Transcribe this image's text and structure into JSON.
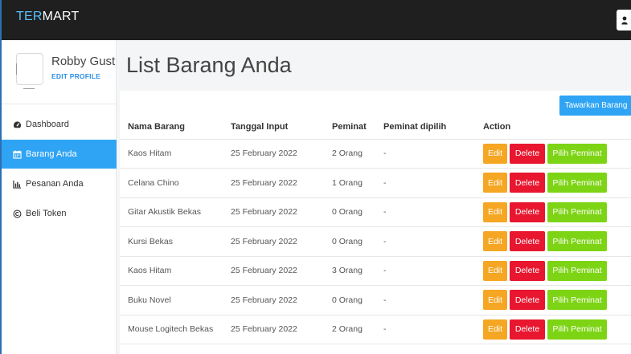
{
  "app": {
    "brand_prefix": "TER",
    "brand_suffix": "MART"
  },
  "user": {
    "name": "Robby Gust...",
    "edit_profile_label": "EDIT PROFILE"
  },
  "sidebar": {
    "items": [
      {
        "label": "Dashboard",
        "icon": "tachometer-icon",
        "active": false
      },
      {
        "label": "Barang Anda",
        "icon": "calendar-icon",
        "active": true
      },
      {
        "label": "Pesanan Anda",
        "icon": "bar-chart-icon",
        "active": false
      },
      {
        "label": "Beli Token",
        "icon": "copyright-icon",
        "active": false
      }
    ]
  },
  "main": {
    "title": "List Barang Anda",
    "offer_button_label": "Tawarkan Barang",
    "table": {
      "headers": [
        "Nama Barang",
        "Tanggal Input",
        "Peminat",
        "Peminat dipilih",
        "Action"
      ],
      "rows": [
        {
          "name": "Kaos Hitam",
          "date": "25 February 2022",
          "peminat": "2 Orang",
          "dipilih": "-"
        },
        {
          "name": "Celana Chino",
          "date": "25 February 2022",
          "peminat": "1 Orang",
          "dipilih": "-"
        },
        {
          "name": "Gitar Akustik Bekas",
          "date": "25 February 2022",
          "peminat": "0 Orang",
          "dipilih": "-"
        },
        {
          "name": "Kursi Bekas",
          "date": "25 February 2022",
          "peminat": "0 Orang",
          "dipilih": "-"
        },
        {
          "name": "Kaos Hitam",
          "date": "25 February 2022",
          "peminat": "3 Orang",
          "dipilih": "-"
        },
        {
          "name": "Buku Novel",
          "date": "25 February 2022",
          "peminat": "0 Orang",
          "dipilih": "-"
        },
        {
          "name": "Mouse Logitech Bekas",
          "date": "25 February 2022",
          "peminat": "2 Orang",
          "dipilih": "-"
        }
      ],
      "actions": {
        "edit_label": "Edit",
        "delete_label": "Delete",
        "pick_label": "Pilih Peminat"
      }
    }
  },
  "colors": {
    "topbar": "#1f1f1f",
    "accent_blue": "#2fa4f4",
    "edit_orange": "#f5a623",
    "delete_red": "#e8162f",
    "pick_green": "#7dd414"
  }
}
